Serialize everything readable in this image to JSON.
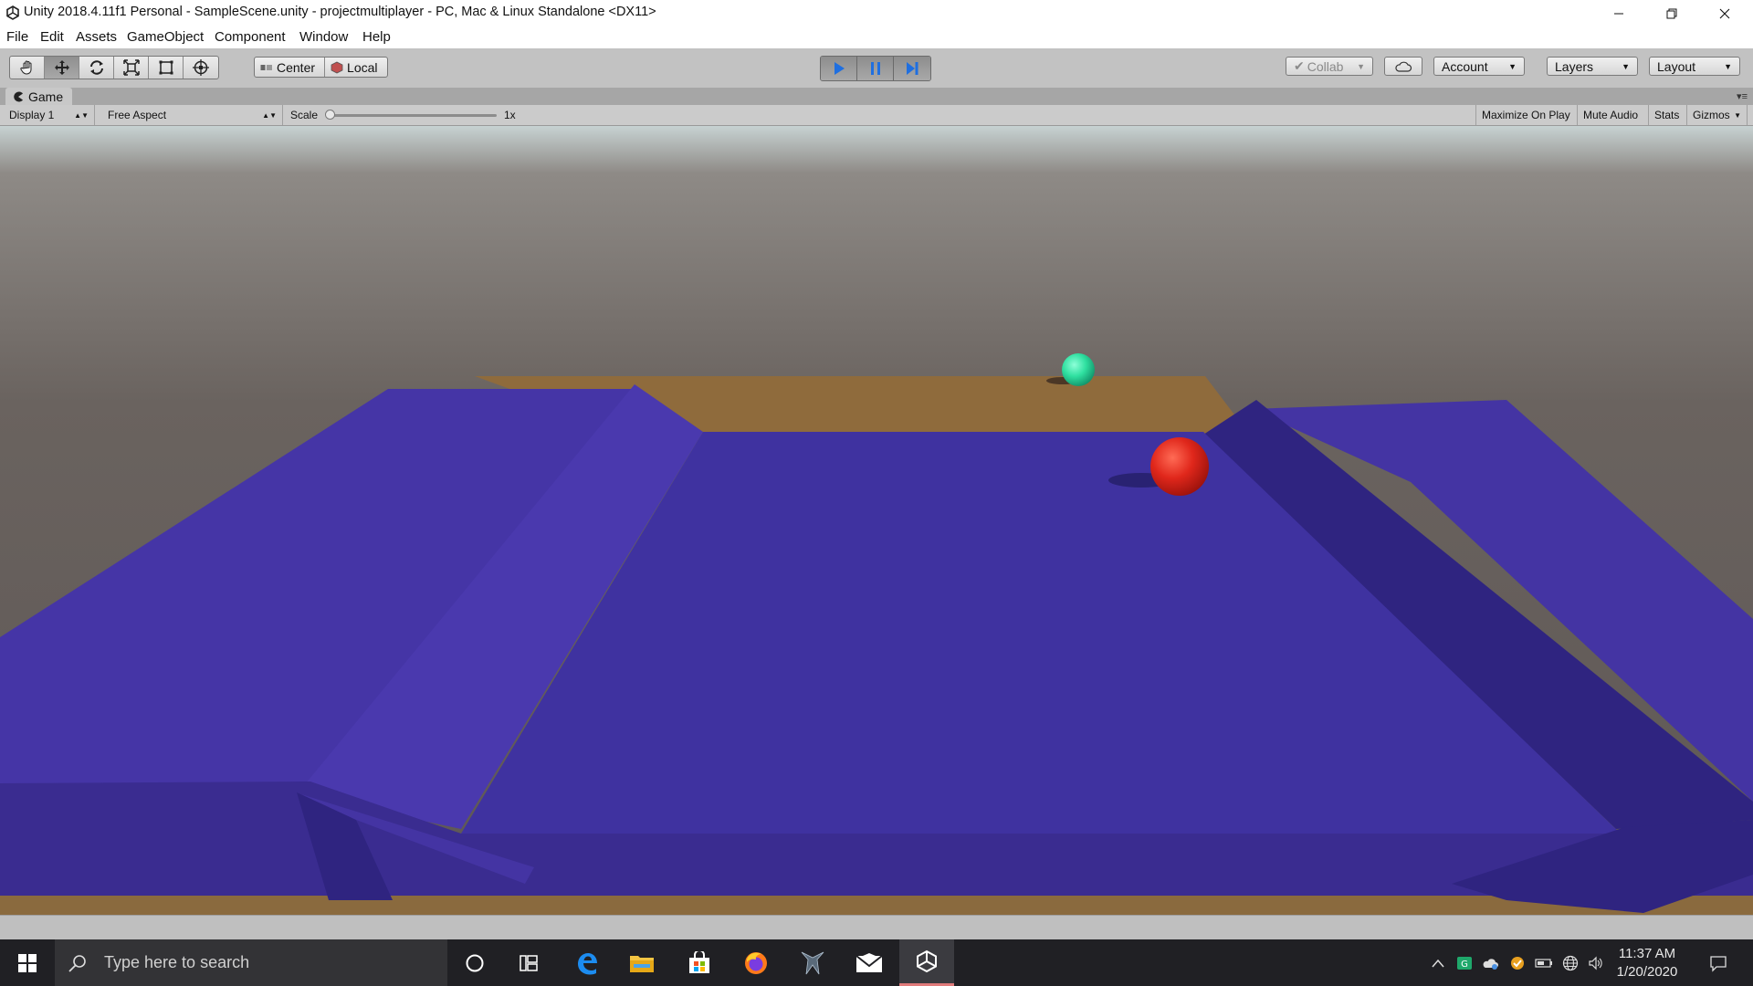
{
  "window": {
    "title": "Unity 2018.4.11f1 Personal - SampleScene.unity - projectmultiplayer - PC, Mac & Linux Standalone <DX11>",
    "icon": "unity-logo-icon"
  },
  "menu": [
    "File",
    "Edit",
    "Assets",
    "GameObject",
    "Component",
    "Window",
    "Help"
  ],
  "toolbar": {
    "tools": [
      "hand-tool-icon",
      "move-tool-icon",
      "rotate-tool-icon",
      "scale-tool-icon",
      "rect-tool-icon",
      "transform-tool-icon"
    ],
    "active_tool": "move-tool-icon",
    "pivot_mode": "Center",
    "pivot_rotation": "Local",
    "play_state": "playing",
    "collab": "Collab",
    "account": "Account",
    "layers": "Layers",
    "layout": "Layout"
  },
  "game_panel": {
    "tab_label": "Game",
    "display": "Display 1",
    "aspect": "Free Aspect",
    "scale_label": "Scale",
    "scale_value": "1x",
    "maximize_on_play": "Maximize On Play",
    "mute_audio": "Mute Audio",
    "stats": "Stats",
    "gizmos": "Gizmos"
  },
  "scene_colors": {
    "sky_top": "#c7d2d2",
    "sky_bottom": "#6a635f",
    "floor": "#4434a3",
    "floor_shadow": "#2f2480",
    "wood": "#8f6b3c",
    "player_red": "#e0271b",
    "player_green": "#2fe0a0"
  },
  "taskbar": {
    "search_placeholder": "Type here to search",
    "apps": [
      "cortana-icon",
      "task-view-icon",
      "edge-icon",
      "file-explorer-icon",
      "store-icon",
      "firefox-icon",
      "predator-icon",
      "mail-icon",
      "unity-icon"
    ],
    "active_app": "unity-icon",
    "time": "11:37 AM",
    "date": "1/20/2020"
  }
}
